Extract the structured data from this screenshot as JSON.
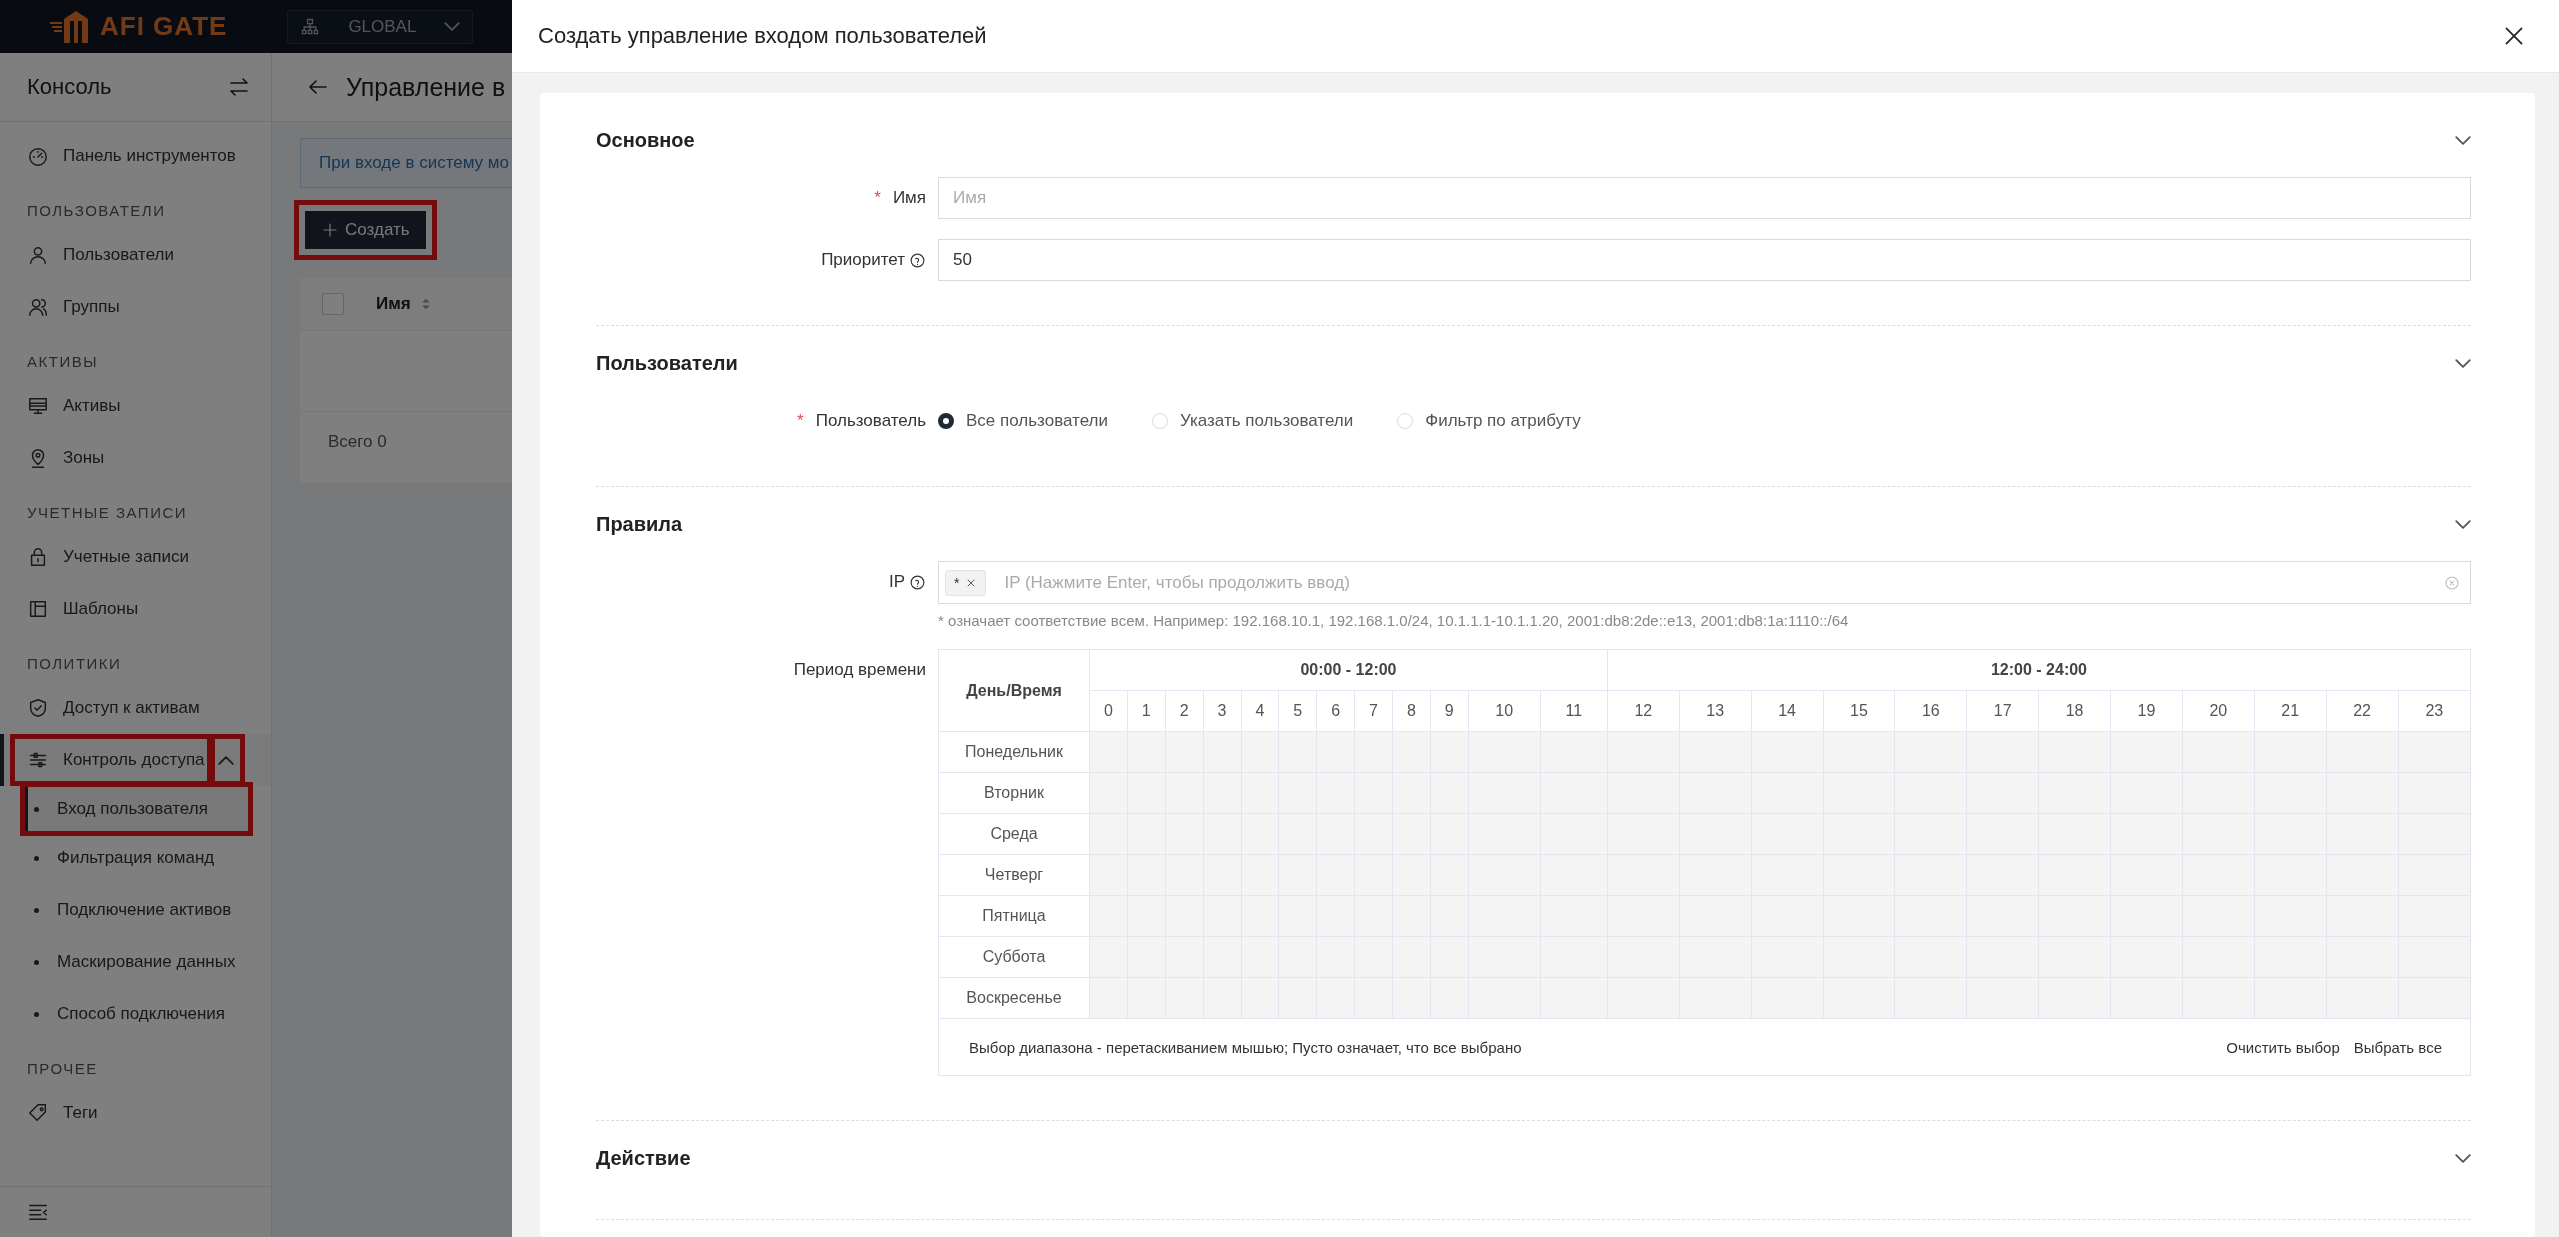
{
  "topbar": {
    "brand": "AFI GATE",
    "org_selector": "GLOBAL"
  },
  "sidebar": {
    "title": "Консоль",
    "items": [
      {
        "kind": "item",
        "label": "Панель инструментов",
        "selected": false
      },
      {
        "kind": "heading",
        "label": "ПОЛЬЗОВАТЕЛИ"
      },
      {
        "kind": "item",
        "label": "Пользователи",
        "selected": false
      },
      {
        "kind": "item",
        "label": "Группы",
        "selected": false
      },
      {
        "kind": "heading",
        "label": "АКТИВЫ"
      },
      {
        "kind": "item",
        "label": "Активы",
        "selected": false
      },
      {
        "kind": "item",
        "label": "Зоны",
        "selected": false
      },
      {
        "kind": "heading",
        "label": "УЧЕТНЫЕ ЗАПИСИ"
      },
      {
        "kind": "item",
        "label": "Учетные записи",
        "selected": false
      },
      {
        "kind": "item",
        "label": "Шаблоны",
        "selected": false
      },
      {
        "kind": "heading",
        "label": "ПОЛИТИКИ"
      },
      {
        "kind": "item",
        "label": "Доступ к активам",
        "selected": false
      },
      {
        "kind": "group",
        "label": "Контроль доступа",
        "selected": true,
        "expanded": true,
        "highlighted": true,
        "children": [
          {
            "label": "Вход пользователя",
            "selected": true,
            "highlighted": true
          },
          {
            "label": "Фильтрация команд",
            "selected": false,
            "highlighted": false
          },
          {
            "label": "Подключение активов",
            "selected": false,
            "highlighted": false
          },
          {
            "label": "Маскирование данных",
            "selected": false,
            "highlighted": false
          },
          {
            "label": "Способ подключения",
            "selected": false,
            "highlighted": false
          }
        ]
      },
      {
        "kind": "heading",
        "label": "ПРОЧЕЕ"
      },
      {
        "kind": "item",
        "label": "Теги",
        "selected": false
      }
    ]
  },
  "page": {
    "title": "Управление в",
    "notice": "При входе в систему мо",
    "create_button": {
      "label": "Создать",
      "highlighted": true
    },
    "table": {
      "select_all": {
        "checked": false
      },
      "columns": [
        {
          "label": "Имя"
        }
      ],
      "total": "Всего 0"
    }
  },
  "drawer": {
    "title": "Создать управление входом пользователей",
    "sections": [
      {
        "title": "Основное",
        "fields": [
          {
            "kind": "text",
            "label": "Имя",
            "required": true,
            "help": false,
            "placeholder": "Имя"
          },
          {
            "kind": "text",
            "label": "Приоритет",
            "required": false,
            "help": true,
            "value": "50"
          }
        ]
      },
      {
        "title": "Пользователи",
        "fields": [
          {
            "kind": "radio",
            "label": "Пользователь",
            "required": true,
            "help": false,
            "options": [
              {
                "label": "Все пользователи",
                "selected": true
              },
              {
                "label": "Указать пользователи",
                "selected": false
              },
              {
                "label": "Фильтр по атрибуту",
                "selected": false
              }
            ]
          }
        ]
      },
      {
        "title": "Правила",
        "fields": [
          {
            "kind": "tags",
            "label": "IP",
            "required": false,
            "help": true,
            "tags": [
              "*"
            ],
            "placeholder": "IP (Нажмите Enter, чтобы продолжить ввод)",
            "hint": "* означает соответствие всем. Например: 192.168.10.1, 192.168.1.0/24, 10.1.1.1-10.1.1.20, 2001:db8:2de::e13, 2001:db8:1a:1110::/64"
          },
          {
            "kind": "schedule",
            "label": "Период времени",
            "required": false,
            "help": false,
            "corner": "День/Время",
            "ranges": [
              "00:00 - 12:00",
              "12:00 - 24:00"
            ],
            "hours": [
              "0",
              "1",
              "2",
              "3",
              "4",
              "5",
              "6",
              "7",
              "8",
              "9",
              "10",
              "11",
              "12",
              "13",
              "14",
              "15",
              "16",
              "17",
              "18",
              "19",
              "20",
              "21",
              "22",
              "23"
            ],
            "days": [
              "Понедельник",
              "Вторник",
              "Среда",
              "Четверг",
              "Пятница",
              "Суббота",
              "Воскресенье"
            ],
            "note": "Выбор диапазона - перетаскиванием мышью; Пусто означает, что все выбрано",
            "actions": [
              "Очистить выбор",
              "Выбрать все"
            ]
          }
        ]
      },
      {
        "title": "Действие"
      }
    ]
  }
}
